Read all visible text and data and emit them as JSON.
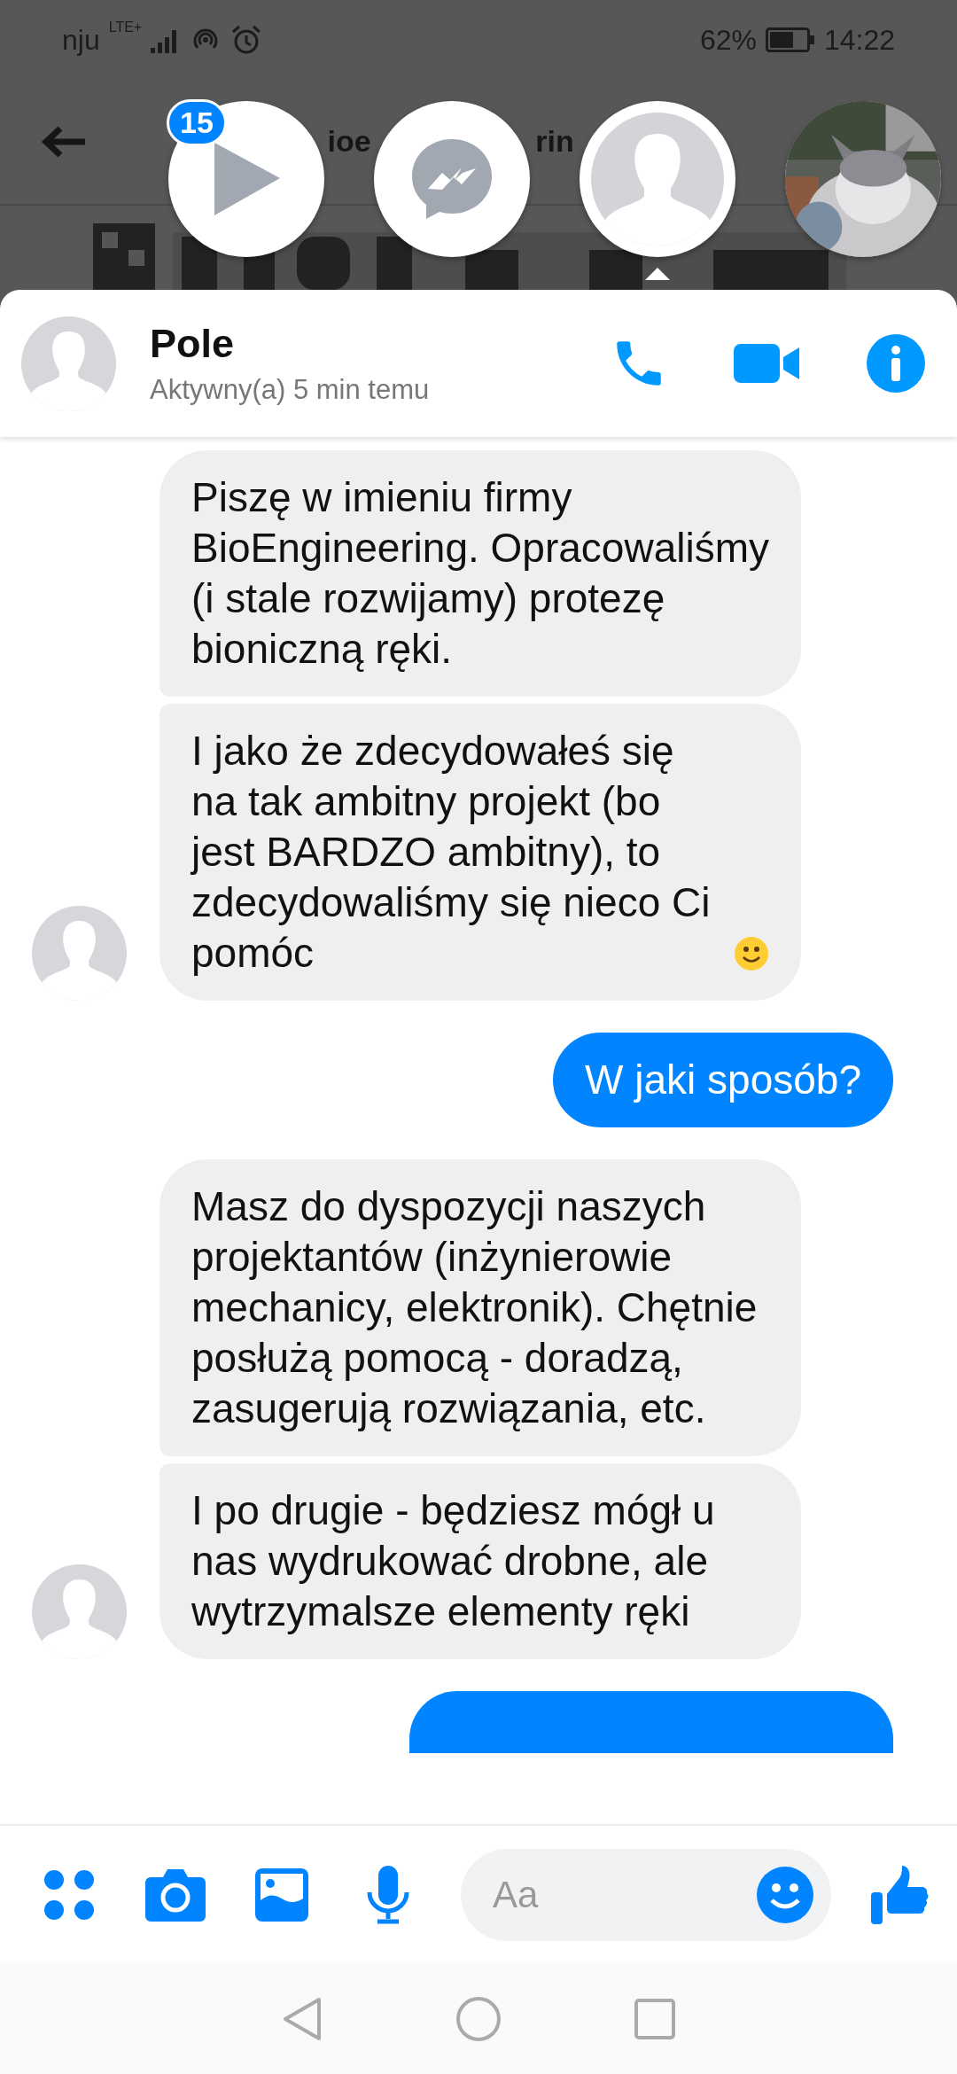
{
  "status_bar": {
    "carrier": "nju",
    "network": "LTE+",
    "battery": "62%",
    "time": "14:22"
  },
  "background_page": {
    "title_fragments": [
      "ioe",
      "rin"
    ]
  },
  "chat_heads": {
    "badge": "15"
  },
  "header": {
    "name": "Pole",
    "status": "Aktywny(a) 5 min temu"
  },
  "groups": [
    {
      "kind": "received",
      "messages": [
        {
          "text": "Piszę w imieniu firmy BioEngineering. Opracowaliśmy (i stale rozwijamy) protezę bioniczną ręki.",
          "emoji": false
        },
        {
          "text": "I jako że zdecydowałeś się na tak ambitny projekt (bo jest BARDZO ambitny), to zdecydowaliśmy się nieco Ci pomóc",
          "emoji": true
        }
      ]
    },
    {
      "kind": "sent",
      "messages": [
        {
          "text": "W jaki sposób?",
          "emoji": false
        }
      ]
    },
    {
      "kind": "received",
      "messages": [
        {
          "text": "Masz do dyspozycji naszych projektantów (inżynierowie mechanicy, elektronik). Chętnie  posłużą pomocą - doradzą, zasugerują rozwiązania, etc.",
          "emoji": false
        },
        {
          "text": "I po drugie - będziesz mógł u nas wydrukować drobne, ale wytrzymalsze elementy ręki",
          "emoji": false
        }
      ]
    }
  ],
  "composer": {
    "placeholder": "Aa"
  }
}
